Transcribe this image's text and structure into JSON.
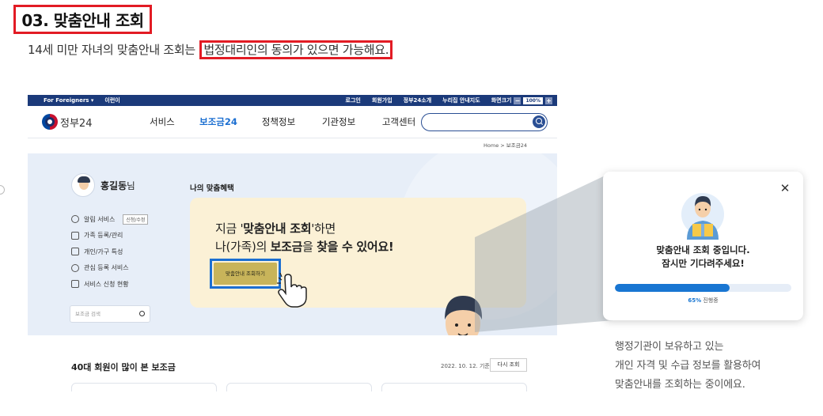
{
  "step": {
    "title": "03. 맞춤안내 조회"
  },
  "subtitle": {
    "prefix": "14세 미만 자녀의 맞춤안내 조회는 ",
    "highlight": "법정대리인의 동의가 있으면 가능해요."
  },
  "site": {
    "topbar": {
      "foreigners": "For Foreigners ▾",
      "lang": "이런이",
      "links": [
        "로그인",
        "회원가입",
        "정부24소개",
        "누리집 안내지도"
      ],
      "zoom_label": "화면크기",
      "zoom_value": "100%",
      "zoom_minus": "−",
      "zoom_plus": "+"
    },
    "logo": "정부24",
    "menu": [
      "서비스",
      "보조금24",
      "정책정보",
      "기관정보",
      "고객센터"
    ],
    "menu_active": 1,
    "breadcrumb": "Home  >  보조금24",
    "user": {
      "name": "홍길동",
      "suffix": "님"
    },
    "side_menu": [
      {
        "label": "알림 서비스",
        "tag": "신청/수정"
      },
      {
        "label": "가족 등록/관리",
        "tag": ""
      },
      {
        "label": "개인/가구 특성",
        "tag": ""
      },
      {
        "label": "관심 등록 서비스",
        "tag": ""
      },
      {
        "label": "서비스 신청 현황",
        "tag": ""
      }
    ],
    "side_search_placeholder": "보조금 검색",
    "benefit_label": "나의 맞춤혜택",
    "card": {
      "line1_pre": "지금 '",
      "line1_bold": "맞춤안내 조회",
      "line1_post": "'하면",
      "line2_pre": "나(가족)의 ",
      "line2_bold1": "보조금",
      "line2_mid": "을 ",
      "line2_bold2": "찾을 수 있어요!"
    },
    "cta_label": "맞춤안내 조회하기",
    "section": {
      "title": "40대 회원이 많이 본 보조금",
      "date": "2022. 10. 12. 기준",
      "reload": "다시 조회"
    }
  },
  "popup": {
    "message_line1": "맞춤안내 조회 중입니다.",
    "message_line2": "잠시만 기다려주세요!",
    "progress_percent": 65,
    "progress_value_text": "65%",
    "progress_suffix": " 진행중",
    "close_icon": "close-icon"
  },
  "caption": [
    "행정기관이 보유하고 있는",
    "개인 자격 및 수급 정보를 활용하여",
    "맞춤안내를 조회하는 중이에요."
  ],
  "colors": {
    "accent_red": "#e21b24",
    "brand_navy": "#1b3a7a",
    "brand_blue": "#1976d2",
    "card_yellow": "#fbf1d6"
  }
}
